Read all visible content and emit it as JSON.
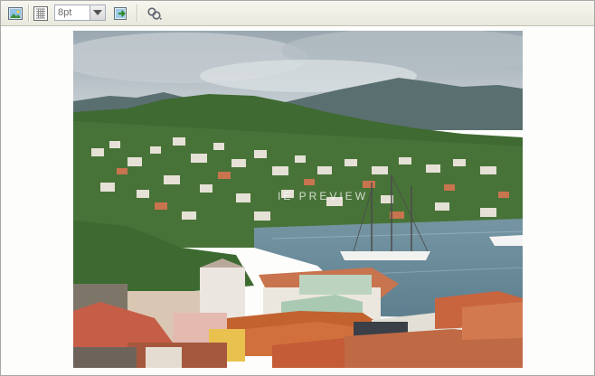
{
  "toolbar": {
    "insert_image_icon": "image-icon",
    "grid_icon": "grid-icon",
    "font_size_value": "8pt",
    "dropdown_icon": "chevron-down-icon",
    "export_icon": "export-arrow-icon",
    "link_icon": "chain-link-icon"
  },
  "preview": {
    "watermark": "IE PREVIEW"
  },
  "colors": {
    "toolbar_bg": "#ecebe0",
    "sky": "#b8c4cc",
    "water": "#7d9aa8",
    "roof_red": "#c0563a"
  }
}
